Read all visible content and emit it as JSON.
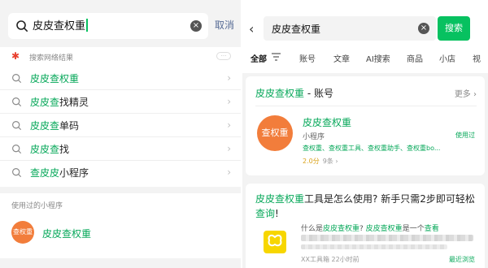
{
  "colors": {
    "accent": "#07c160",
    "highlight_green": "#07a85a",
    "cancel_blue": "#576b95",
    "logo_orange": "#f27d3b",
    "web_star": "#e8402f"
  },
  "left": {
    "search": {
      "query": "皮皮查权重",
      "cancel": "取消"
    },
    "web_results_label": "搜索网络结果",
    "suggestions": [
      {
        "hl": "皮皮查权重",
        "rest": ""
      },
      {
        "hl": "皮皮查",
        "rest": "找精灵"
      },
      {
        "hl": "皮皮查",
        "rest": "单码"
      },
      {
        "hl": "皮皮查",
        "rest": "找"
      },
      {
        "hl": "查皮皮",
        "rest": "小程序"
      }
    ],
    "used_section": {
      "heading": "使用过的小程序",
      "logo_text": "查权重",
      "name": "皮皮查权重"
    }
  },
  "right": {
    "search": {
      "query": "皮皮查权重",
      "button": "搜索"
    },
    "tabs": [
      "全部",
      "账号",
      "文章",
      "AI搜索",
      "商品",
      "小店",
      "视"
    ],
    "account_card": {
      "title_hl": "皮皮查权重",
      "title_rest": " - 账号",
      "more": "更多 ›",
      "logo_text": "查权重",
      "name": "皮皮查权重",
      "type": "小程序",
      "used": "使用过",
      "tags": "查权重、查权重工具、查权重助手、查权重bo...",
      "score": "2.0分",
      "count": "9条 ›"
    },
    "article_card": {
      "title_hl1": "皮皮查权重",
      "title_mid": "工具是怎么使用? 新手只需2步即可轻松",
      "title_hl2": "查询",
      "title_end": "!",
      "snippet_pre": "什么是",
      "snippet_hl1": "皮皮查权重",
      "snippet_mid": "? ",
      "snippet_hl2": "皮皮查权重",
      "snippet_end": "是一个",
      "snippet_hl3": "查看",
      "source": "XX工具箱  22小时前",
      "used": "最近浏览"
    }
  }
}
